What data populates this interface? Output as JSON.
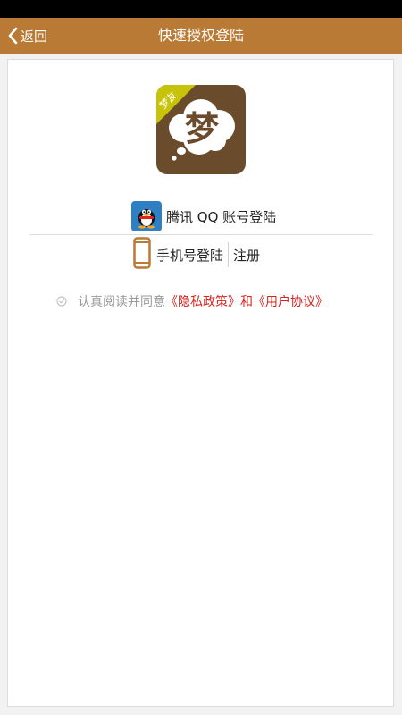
{
  "nav": {
    "back_label": "返回",
    "title": "快速授权登陆"
  },
  "logo": {
    "char": "梦",
    "ribbon": "梦友"
  },
  "login": {
    "qq_label": "腾讯 QQ 账号登陆",
    "phone_label": "手机号登陆",
    "register_label": "注册"
  },
  "agreement": {
    "text": "认真阅读并同意",
    "privacy_link": "《隐私政策》",
    "and": "和",
    "user_link": "《用户协议》"
  },
  "colors": {
    "navbar": "#b97a35",
    "logo_bg": "#6a4c2c",
    "logo_ribbon": "#c7c20a",
    "link": "#d9201b",
    "qq_bg": "#2f7fc3"
  }
}
